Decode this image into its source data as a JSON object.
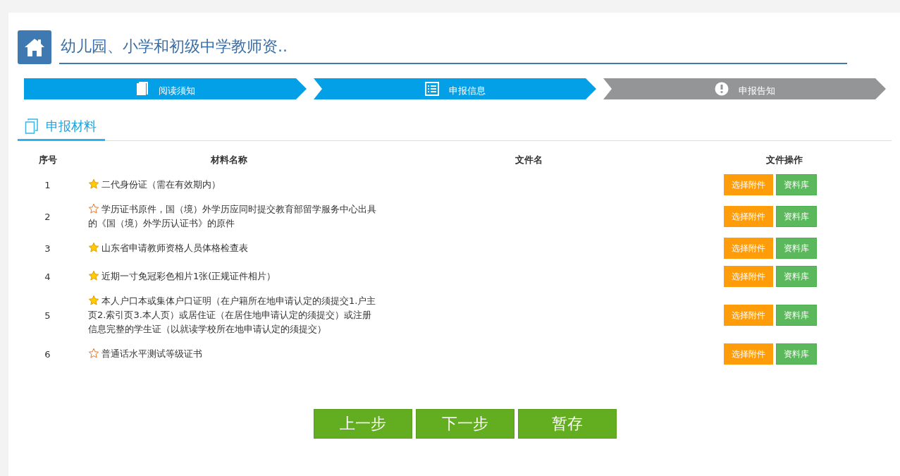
{
  "header": {
    "title": "幼儿园、小学和初级中学教师资.."
  },
  "steps": [
    {
      "label": "阅读须知",
      "kind": "book",
      "completed": true
    },
    {
      "label": "申报信息",
      "kind": "list",
      "completed": true
    },
    {
      "label": "申报告知",
      "kind": "alert",
      "completed": false
    }
  ],
  "section_tab": {
    "label": "申报材料"
  },
  "table": {
    "columns": [
      "序号",
      "材料名称",
      "文件名",
      "文件操作"
    ],
    "rows": [
      {
        "index": "1",
        "name": "二代身份证（需在有效期内）",
        "required": true,
        "actions": [
          "选择附件",
          "资料库"
        ]
      },
      {
        "index": "2",
        "name": "学历证书原件，国（境）外学历应同时提交教育部留学服务中心出具的《国（境）外学历认证书》的原件",
        "required": false,
        "actions": [
          "选择附件",
          "资料库"
        ]
      },
      {
        "index": "3",
        "name": "山东省申请教师资格人员体格检查表",
        "required": true,
        "actions": [
          "选择附件",
          "资料库"
        ]
      },
      {
        "index": "4",
        "name": "近期一寸免冠彩色相片1张(正规证件相片）",
        "required": true,
        "actions": [
          "选择附件",
          "资料库"
        ]
      },
      {
        "index": "5",
        "name": "本人户口本或集体户口证明（在户籍所在地申请认定的须提交1.户主页2.索引页3.本人页）或居住证（在居住地申请认定的须提交）或注册信息完整的学生证（以就读学校所在地申请认定的须提交）",
        "required": true,
        "actions": [
          "选择附件",
          "资料库"
        ]
      },
      {
        "index": "6",
        "name": "普通话水平测试等级证书",
        "required": false,
        "actions": [
          "选择附件",
          "资料库"
        ]
      }
    ]
  },
  "footer_buttons": [
    "上一步",
    "下一步",
    "暂存"
  ]
}
